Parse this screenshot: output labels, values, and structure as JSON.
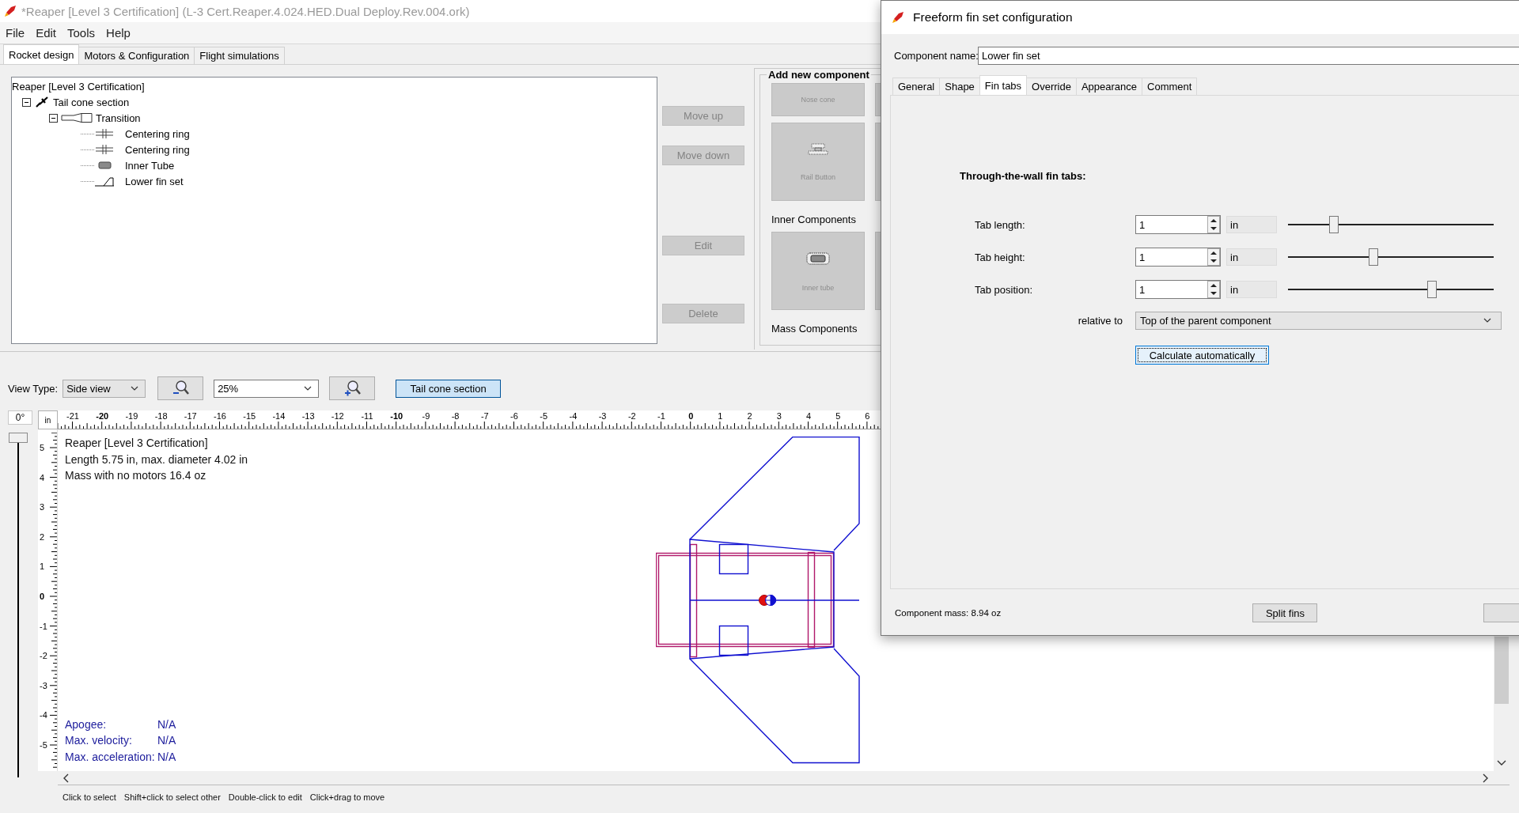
{
  "window": {
    "title": "*Reaper [Level 3 Certification] (L-3 Cert.Reaper.4.024.HED.Dual Deploy.Rev.004.ork)"
  },
  "menu": [
    "File",
    "Edit",
    "Tools",
    "Help"
  ],
  "tabs": [
    {
      "label": "Rocket design",
      "selected": true
    },
    {
      "label": "Motors & Configuration",
      "selected": false
    },
    {
      "label": "Flight simulations",
      "selected": false
    }
  ],
  "tree": {
    "label": "Reaper [Level 3 Certification]",
    "children": [
      {
        "label": "Tail cone section",
        "kind": "stage",
        "expanded": true,
        "children": [
          {
            "label": "Transition",
            "kind": "transition",
            "expanded": true,
            "children": [
              {
                "label": "Centering ring",
                "kind": "ring"
              },
              {
                "label": "Centering ring",
                "kind": "ring"
              },
              {
                "label": "Inner Tube",
                "kind": "inner_tube"
              },
              {
                "label": "Lower fin set",
                "kind": "fin_set"
              }
            ]
          }
        ]
      }
    ]
  },
  "tree_buttons": [
    {
      "label": "Move up",
      "disabled": true
    },
    {
      "label": "Move down",
      "disabled": true
    },
    {
      "label": "Edit",
      "disabled": true
    },
    {
      "label": "Delete",
      "disabled": true
    }
  ],
  "add_component": {
    "title": "Add new component",
    "sections": [
      {
        "items": [
          {
            "label": "Nose cone",
            "kind": "nose_cone"
          },
          {
            "label": "Rail Button",
            "kind": "rail_button"
          }
        ]
      },
      {
        "heading": "Inner Components",
        "items": [
          {
            "label": "Inner tube",
            "kind": "inner_tube"
          }
        ]
      },
      {
        "heading": "Mass Components"
      }
    ]
  },
  "toolbar": {
    "view_type_label": "View Type:",
    "view_type": "Side view",
    "zoom": "25%",
    "component_button": {
      "label": "Tail cone section",
      "selected": true
    }
  },
  "rotation": {
    "reading": "0°",
    "level": 0
  },
  "ruler": {
    "unit": "in",
    "x_labels": [
      {
        "label": "-21",
        "major": false
      },
      {
        "label": "-20",
        "major": true
      },
      {
        "label": "-19",
        "major": false
      },
      {
        "label": "-18",
        "major": false
      },
      {
        "label": "-17",
        "major": false
      },
      {
        "label": "-16",
        "major": false
      },
      {
        "label": "-15",
        "major": false
      },
      {
        "label": "-14",
        "major": false
      },
      {
        "label": "-13",
        "major": false
      },
      {
        "label": "-12",
        "major": false
      },
      {
        "label": "-11",
        "major": false
      },
      {
        "label": "-10",
        "major": true
      },
      {
        "label": "-9",
        "major": false
      },
      {
        "label": "-8",
        "major": false
      },
      {
        "label": "-7",
        "major": false
      },
      {
        "label": "-6",
        "major": false
      },
      {
        "label": "-5",
        "major": false
      },
      {
        "label": "-4",
        "major": false
      },
      {
        "label": "-3",
        "major": false
      },
      {
        "label": "-2",
        "major": false
      },
      {
        "label": "-1",
        "major": false
      },
      {
        "label": "0",
        "major": true
      },
      {
        "label": "1",
        "major": false
      },
      {
        "label": "2",
        "major": false
      },
      {
        "label": "3",
        "major": false
      },
      {
        "label": "4",
        "major": false
      },
      {
        "label": "5",
        "major": false
      },
      {
        "label": "6",
        "major": false
      }
    ],
    "y_labels": [
      {
        "label": "5",
        "major": false
      },
      {
        "label": "4",
        "major": false
      },
      {
        "label": "3",
        "major": false
      },
      {
        "label": "2",
        "major": false
      },
      {
        "label": "1",
        "major": false
      },
      {
        "label": "0",
        "major": true
      },
      {
        "label": "-1",
        "major": false
      },
      {
        "label": "-2",
        "major": false
      },
      {
        "label": "-3",
        "major": false
      },
      {
        "label": "-4",
        "major": false
      },
      {
        "label": "-5",
        "major": false
      }
    ]
  },
  "canvas_info": [
    "Reaper [Level 3 Certification]",
    "Length 5.75 in, max. diameter 4.02 in",
    "Mass with no motors 16.4 oz"
  ],
  "flight_info": [
    {
      "label": "Apogee:",
      "value": "N/A"
    },
    {
      "label": "Max. velocity:",
      "value": "N/A"
    },
    {
      "label": "Max. acceleration:",
      "value": "N/A"
    }
  ],
  "hints": [
    "Click to select",
    "Shift+click to select other",
    "Double-click to edit",
    "Click+drag to move"
  ],
  "dialog": {
    "title": "Freeform fin set configuration",
    "name_label": "Component name:",
    "name_value": "Lower fin set",
    "tabs": [
      {
        "label": "General",
        "selected": false
      },
      {
        "label": "Shape",
        "selected": false
      },
      {
        "label": "Fin tabs",
        "selected": true
      },
      {
        "label": "Override",
        "selected": false
      },
      {
        "label": "Appearance",
        "selected": false
      },
      {
        "label": "Comment",
        "selected": false
      }
    ],
    "heading": "Through-the-wall fin tabs:",
    "fields": [
      {
        "label": "Tab length:",
        "value": "1",
        "unit": "in",
        "level": 0.21
      },
      {
        "label": "Tab height:",
        "value": "1",
        "unit": "in",
        "level": 0.41
      },
      {
        "label": "Tab position:",
        "value": "1",
        "unit": "in",
        "level": 0.71
      }
    ],
    "relative_label": "relative to",
    "relative_value": "Top of the parent component",
    "calc_button": "Calculate automatically",
    "mass": "Component mass: 8.94 oz",
    "split_button": "Split fins"
  }
}
